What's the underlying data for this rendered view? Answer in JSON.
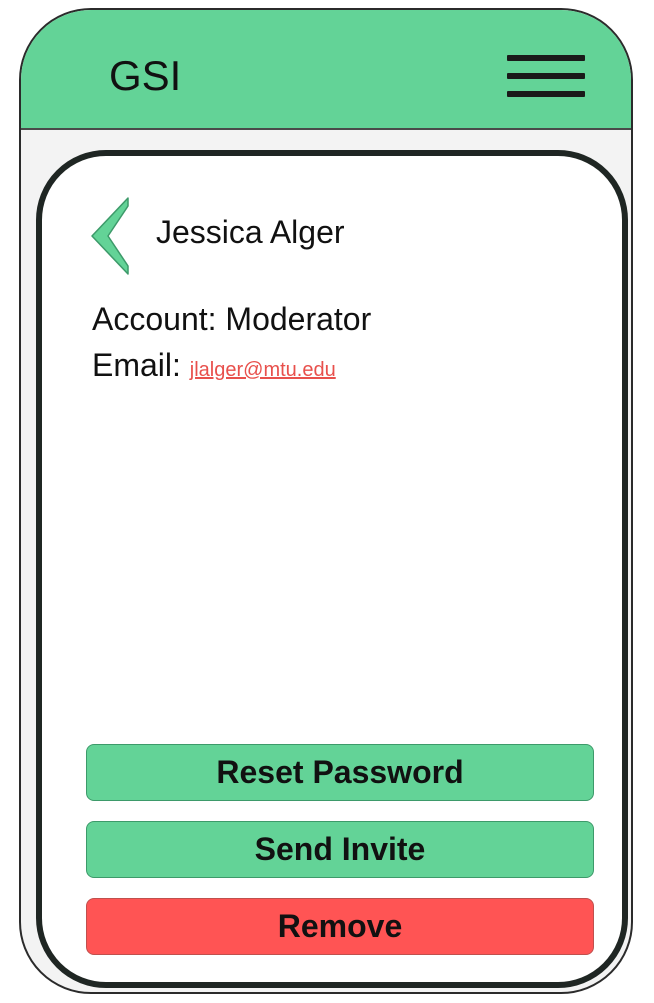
{
  "header": {
    "app_title": "GSI",
    "menu_icon": "hamburger-menu-icon"
  },
  "profile": {
    "back_icon": "chevron-left-icon",
    "name": "Jessica Alger",
    "account_label": "Account:",
    "account_value": "Moderator",
    "email_label": "Email:",
    "email_value": "jlalger@mtu.edu"
  },
  "actions": {
    "reset_password": "Reset Password",
    "send_invite": "Send Invite",
    "remove": "Remove"
  },
  "colors": {
    "accent_green": "#63d397",
    "danger_red": "#ff5454",
    "link_red": "#e8504c"
  }
}
